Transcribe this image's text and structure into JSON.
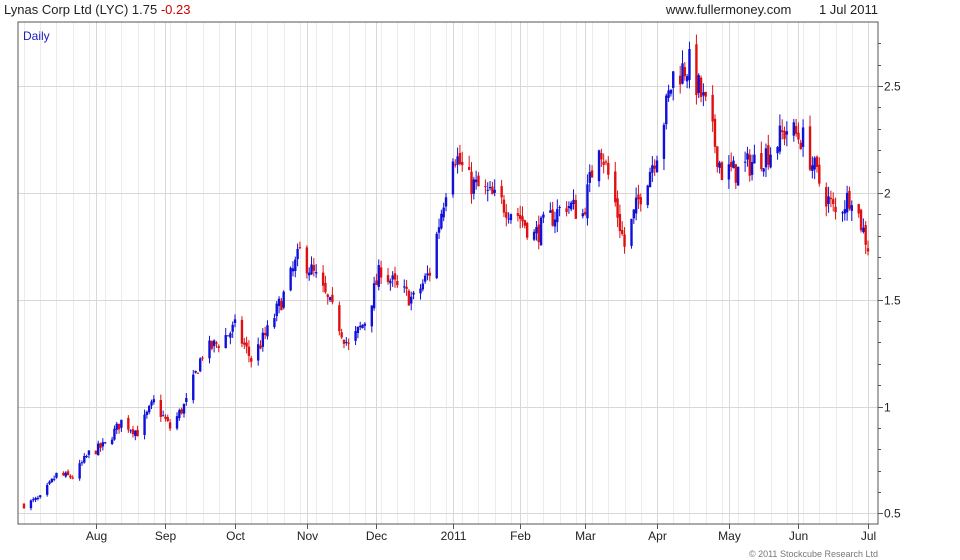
{
  "header": {
    "title": "Lynas Corp Ltd (LYC)",
    "price": "1.75",
    "change": "-0.23",
    "source": "www.fullermoney.com",
    "date": "1 Jul 2011"
  },
  "footer": {
    "copyright": "© 2011 Stockcube Research Ltd"
  },
  "colors": {
    "up": "#1010d8",
    "down": "#e01010",
    "grid": "#d8d8d8",
    "axis": "#555555",
    "interval": "#1c1cc0"
  },
  "chart_data": {
    "type": "candlestick",
    "interval_label": "Daily",
    "y_axis_side": "right",
    "ylim": [
      0.45,
      2.8
    ],
    "xlim": [
      "2010-07-02",
      "2011-07-01"
    ],
    "grid": true,
    "x_ticks": [
      {
        "label": "Aug",
        "date": "2010-08-02"
      },
      {
        "label": "Sep",
        "date": "2010-09-01"
      },
      {
        "label": "Oct",
        "date": "2010-10-01"
      },
      {
        "label": "Nov",
        "date": "2010-11-01"
      },
      {
        "label": "Dec",
        "date": "2010-12-01"
      },
      {
        "label": "2011",
        "date": "2011-01-03"
      },
      {
        "label": "Feb",
        "date": "2011-02-01"
      },
      {
        "label": "Mar",
        "date": "2011-03-01"
      },
      {
        "label": "Apr",
        "date": "2011-04-01"
      },
      {
        "label": "May",
        "date": "2011-05-02"
      },
      {
        "label": "Jun",
        "date": "2011-06-01"
      },
      {
        "label": "Jul",
        "date": "2011-07-01"
      }
    ],
    "y_ticks": [
      {
        "label": "0.5",
        "value": 0.5
      },
      {
        "label": "1",
        "value": 1
      },
      {
        "label": "1.5",
        "value": 1.5
      },
      {
        "label": "2",
        "value": 2
      },
      {
        "label": "2.5",
        "value": 2.5
      }
    ],
    "close_path": [
      [
        "2010-07-02",
        0.54
      ],
      [
        "2010-07-09",
        0.57
      ],
      [
        "2010-07-16",
        0.68
      ],
      [
        "2010-07-23",
        0.67
      ],
      [
        "2010-07-30",
        0.78
      ],
      [
        "2010-08-06",
        0.82
      ],
      [
        "2010-08-13",
        0.93
      ],
      [
        "2010-08-20",
        0.88
      ],
      [
        "2010-08-27",
        1.02
      ],
      [
        "2010-09-03",
        0.9
      ],
      [
        "2010-09-10",
        1.02
      ],
      [
        "2010-09-17",
        1.25
      ],
      [
        "2010-09-24",
        1.3
      ],
      [
        "2010-10-01",
        1.37
      ],
      [
        "2010-10-08",
        1.22
      ],
      [
        "2010-10-15",
        1.35
      ],
      [
        "2010-10-22",
        1.52
      ],
      [
        "2010-10-29",
        1.72
      ],
      [
        "2010-11-05",
        1.6
      ],
      [
        "2010-11-12",
        1.45
      ],
      [
        "2010-11-19",
        1.28
      ],
      [
        "2010-11-26",
        1.4
      ],
      [
        "2010-12-03",
        1.65
      ],
      [
        "2010-12-10",
        1.55
      ],
      [
        "2010-12-17",
        1.5
      ],
      [
        "2010-12-24",
        1.63
      ],
      [
        "2011-01-03",
        2.2
      ],
      [
        "2011-01-10",
        2.05
      ],
      [
        "2011-01-17",
        2.0
      ],
      [
        "2011-01-24",
        1.95
      ],
      [
        "2011-01-31",
        1.9
      ],
      [
        "2011-02-07",
        1.8
      ],
      [
        "2011-02-14",
        1.88
      ],
      [
        "2011-02-21",
        1.95
      ],
      [
        "2011-02-28",
        1.9
      ],
      [
        "2011-03-07",
        2.25
      ],
      [
        "2011-03-14",
        1.95
      ],
      [
        "2011-03-18",
        1.75
      ],
      [
        "2011-03-25",
        2.0
      ],
      [
        "2011-04-01",
        2.2
      ],
      [
        "2011-04-08",
        2.55
      ],
      [
        "2011-04-15",
        2.6
      ],
      [
        "2011-04-22",
        2.4
      ],
      [
        "2011-04-29",
        2.1
      ],
      [
        "2011-05-06",
        2.1
      ],
      [
        "2011-05-13",
        2.15
      ],
      [
        "2011-05-20",
        2.2
      ],
      [
        "2011-05-27",
        2.3
      ],
      [
        "2011-06-03",
        2.25
      ],
      [
        "2011-06-10",
        2.05
      ],
      [
        "2011-06-17",
        1.9
      ],
      [
        "2011-06-24",
        2.0
      ],
      [
        "2011-07-01",
        1.75
      ]
    ]
  }
}
